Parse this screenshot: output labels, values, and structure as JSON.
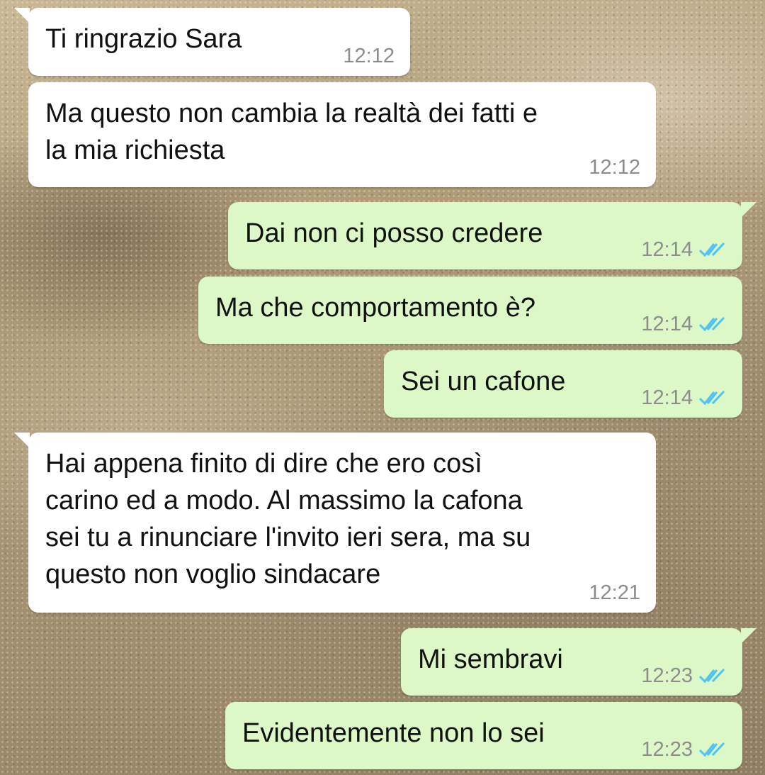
{
  "chat": {
    "messages": [
      {
        "direction": "incoming",
        "text": "Ti ringrazio Sara",
        "time": "12:12"
      },
      {
        "direction": "incoming",
        "text": "Ma questo non cambia la realtà dei fatti e\nla mia richiesta",
        "time": "12:12"
      },
      {
        "direction": "outgoing",
        "text": "Dai non ci posso credere",
        "time": "12:14",
        "status": "read"
      },
      {
        "direction": "outgoing",
        "text": "Ma che comportamento è?",
        "time": "12:14",
        "status": "read"
      },
      {
        "direction": "outgoing",
        "text": "Sei un cafone",
        "time": "12:14",
        "status": "read"
      },
      {
        "direction": "incoming",
        "text": "Hai appena finito di dire che ero così\ncarino ed a modo. Al massimo la cafona\nsei tu a rinunciare l'invito ieri sera, ma su\nquesto non voglio sindacare",
        "time": "12:21"
      },
      {
        "direction": "outgoing",
        "text": "Mi sembravi",
        "time": "12:23",
        "status": "read"
      },
      {
        "direction": "outgoing",
        "text": "Evidentemente non lo sei",
        "time": "12:23",
        "status": "read"
      }
    ]
  },
  "colors": {
    "incoming_bubble": "#ffffff",
    "outgoing_bubble": "#dcf8c6",
    "read_ticks": "#4fc3f7",
    "timestamp": "#8c8c8c"
  },
  "icons": {
    "read_receipt": "double-check-icon"
  }
}
